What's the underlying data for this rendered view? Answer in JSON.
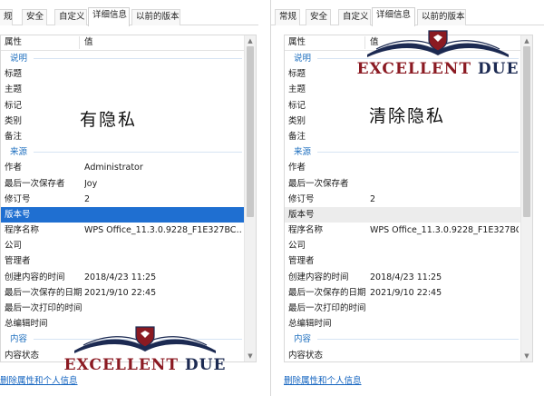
{
  "left": {
    "tabs": [
      "规",
      "安全",
      "自定义",
      "详细信息",
      "以前的版本"
    ],
    "active_tab": 3,
    "header": {
      "property": "属性",
      "value": "值"
    },
    "rows": [
      {
        "type": "group",
        "label": "说明"
      },
      {
        "type": "prop",
        "name": "标题",
        "value": ""
      },
      {
        "type": "prop",
        "name": "主题",
        "value": ""
      },
      {
        "type": "prop",
        "name": "标记",
        "value": ""
      },
      {
        "type": "prop",
        "name": "类别",
        "value": ""
      },
      {
        "type": "prop",
        "name": "备注",
        "value": ""
      },
      {
        "type": "group",
        "label": "来源"
      },
      {
        "type": "prop",
        "name": "作者",
        "value": "Administrator"
      },
      {
        "type": "prop",
        "name": "最后一次保存者",
        "value": "Joy"
      },
      {
        "type": "prop",
        "name": "修订号",
        "value": "2"
      },
      {
        "type": "prop",
        "name": "版本号",
        "value": "",
        "state": "selected"
      },
      {
        "type": "prop",
        "name": "程序名称",
        "value": "WPS Office_11.3.0.9228_F1E327BC…"
      },
      {
        "type": "prop",
        "name": "公司",
        "value": ""
      },
      {
        "type": "prop",
        "name": "管理者",
        "value": ""
      },
      {
        "type": "prop",
        "name": "创建内容的时间",
        "value": "2018/4/23 11:25"
      },
      {
        "type": "prop",
        "name": "最后一次保存的日期",
        "value": "2021/9/10 22:45"
      },
      {
        "type": "prop",
        "name": "最后一次打印的时间",
        "value": ""
      },
      {
        "type": "prop",
        "name": "总编辑时间",
        "value": ""
      },
      {
        "type": "group",
        "label": "内容"
      },
      {
        "type": "prop",
        "name": "内容状态",
        "value": ""
      }
    ],
    "remove_link": "删除属性和个人信息",
    "note": "有隐私"
  },
  "right": {
    "tabs": [
      "常规",
      "安全",
      "自定义",
      "详细信息",
      "以前的版本"
    ],
    "active_tab": 3,
    "header": {
      "property": "属性",
      "value": "值"
    },
    "rows": [
      {
        "type": "group",
        "label": "说明"
      },
      {
        "type": "prop",
        "name": "标题",
        "value": ""
      },
      {
        "type": "prop",
        "name": "主题",
        "value": ""
      },
      {
        "type": "prop",
        "name": "标记",
        "value": ""
      },
      {
        "type": "prop",
        "name": "类别",
        "value": ""
      },
      {
        "type": "prop",
        "name": "备注",
        "value": ""
      },
      {
        "type": "group",
        "label": "来源"
      },
      {
        "type": "prop",
        "name": "作者",
        "value": ""
      },
      {
        "type": "prop",
        "name": "最后一次保存者",
        "value": ""
      },
      {
        "type": "prop",
        "name": "修订号",
        "value": "2"
      },
      {
        "type": "prop",
        "name": "版本号",
        "value": "",
        "state": "hover"
      },
      {
        "type": "prop",
        "name": "程序名称",
        "value": "WPS Office_11.3.0.9228_F1E327BC…"
      },
      {
        "type": "prop",
        "name": "公司",
        "value": ""
      },
      {
        "type": "prop",
        "name": "管理者",
        "value": ""
      },
      {
        "type": "prop",
        "name": "创建内容的时间",
        "value": "2018/4/23 11:25"
      },
      {
        "type": "prop",
        "name": "最后一次保存的日期",
        "value": "2021/9/10 22:45"
      },
      {
        "type": "prop",
        "name": "最后一次打印的时间",
        "value": ""
      },
      {
        "type": "prop",
        "name": "总编辑时间",
        "value": ""
      },
      {
        "type": "group",
        "label": "内容"
      },
      {
        "type": "prop",
        "name": "内容状态",
        "value": ""
      }
    ],
    "remove_link": "删除属性和个人信息",
    "note": "清除隐私"
  },
  "watermark": {
    "text_first": "EXCELLENT",
    "text_second": "DUE"
  },
  "colors": {
    "accent": "#1f6fd1",
    "link": "#1565c0",
    "group": "#1e6fbf",
    "logo_red": "#8b1a22",
    "logo_navy": "#1c2a52"
  }
}
